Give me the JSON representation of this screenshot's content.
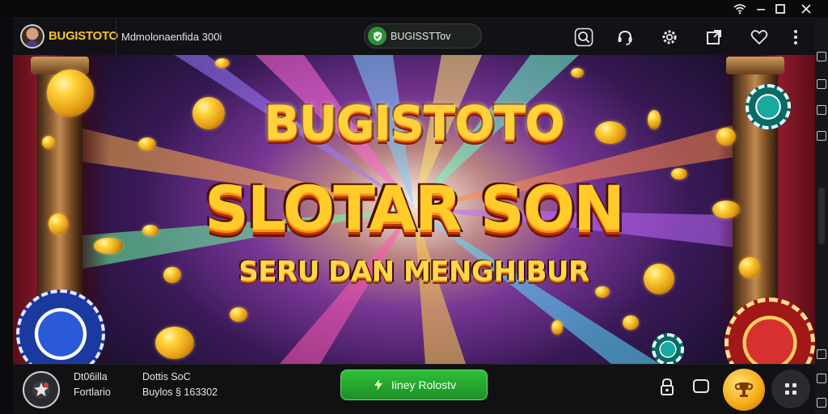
{
  "topbar": {
    "brand": "BUGISTOTO",
    "page_title": "Mdmolonaenfida 300i",
    "tab_label": "BUGISSTTov"
  },
  "banner": {
    "line1": "BUGISTOTO",
    "line2": "SLOTAR SON",
    "line3": "SERU DAN MENGHIBUR"
  },
  "bottombar": {
    "col1_line1": "Dt06illa",
    "col1_line2": "Fortlario",
    "col2_line1": "Dottis SoC",
    "col2_line2": "Buylos § 163302",
    "play_label": "Iiney Rolostv"
  },
  "icons": {
    "wifi": "wifi-icon",
    "minimize": "minimize-icon",
    "maximize": "maximize-icon",
    "close": "close-icon",
    "search": "search-icon",
    "support": "headset-icon",
    "settings": "gear-icon",
    "share": "share-icon",
    "favorite": "heart-icon",
    "more": "more-vertical-icon"
  },
  "colors": {
    "brand": "#f4c430",
    "play": "#2fbf3a",
    "gold": "#f4a812"
  }
}
